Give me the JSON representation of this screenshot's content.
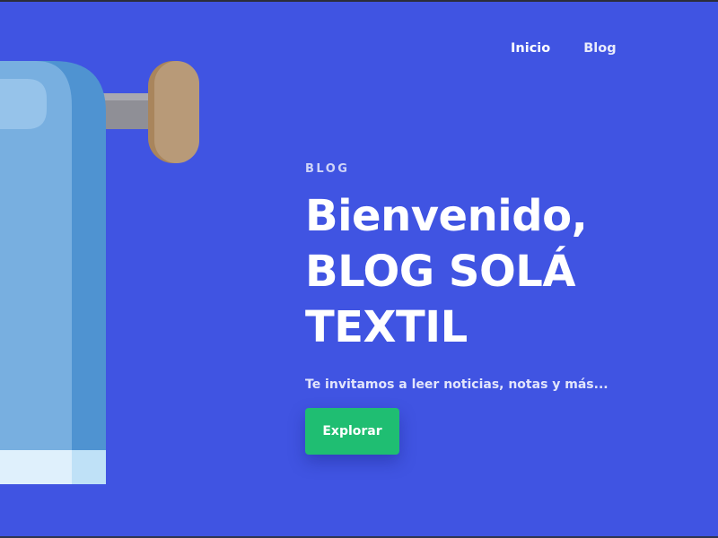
{
  "nav": {
    "items": [
      {
        "label": "Inicio"
      },
      {
        "label": "Blog"
      }
    ]
  },
  "hero": {
    "eyebrow": "BLOG",
    "title_lines": [
      "Bienvenido,",
      "BLOG SOLÁ",
      "TEXTIL"
    ],
    "subtitle": "Te invitamos a leer noticias, notas y más...",
    "cta_label": "Explorar"
  },
  "illustration": {
    "icon": "fabric-roll-icon"
  },
  "colors": {
    "background": "#4054e2",
    "cta": "#1fbe72",
    "text": "#ffffff"
  }
}
